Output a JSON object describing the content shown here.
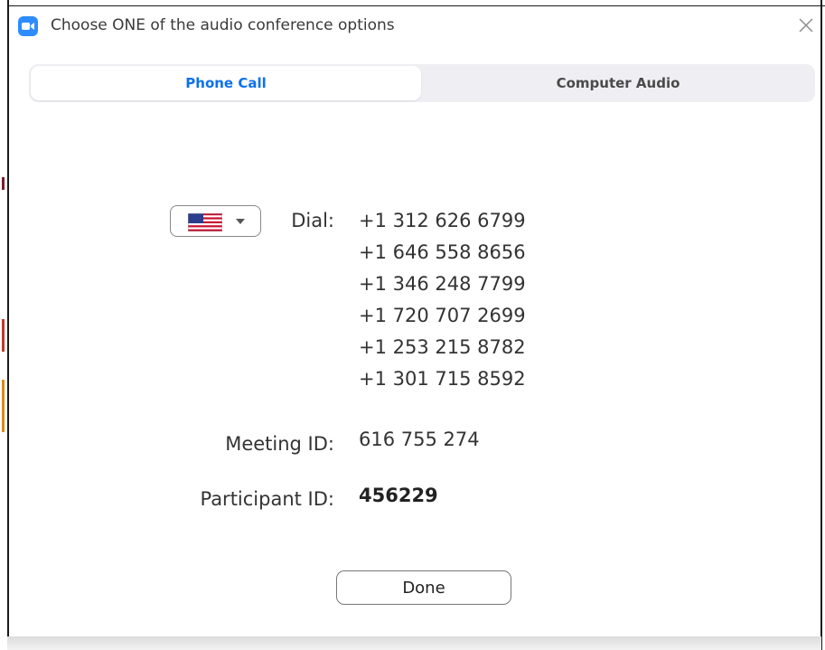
{
  "window": {
    "title": "Choose ONE of the audio conference options",
    "accent_color": "#2d8cff"
  },
  "tabs": [
    {
      "label": "Phone Call",
      "selected": true
    },
    {
      "label": "Computer Audio",
      "selected": false
    }
  ],
  "phone_call": {
    "country": {
      "icon": "us-flag-icon",
      "caret_icon": "caret-down-icon"
    },
    "dial_label": "Dial:",
    "numbers": [
      "+1 312 626 6799",
      "+1 646 558 8656",
      "+1 346 248 7799",
      "+1 720 707 2699",
      "+1 253 215 8782",
      "+1 301 715 8592"
    ],
    "meeting_id_label": "Meeting ID:",
    "meeting_id": "616 755 274",
    "participant_id_label": "Participant ID:",
    "participant_id": "456229"
  },
  "done_label": "Done",
  "colors": {
    "selected_tab_text": "#0e71eb",
    "tab_track": "#efeff3"
  }
}
